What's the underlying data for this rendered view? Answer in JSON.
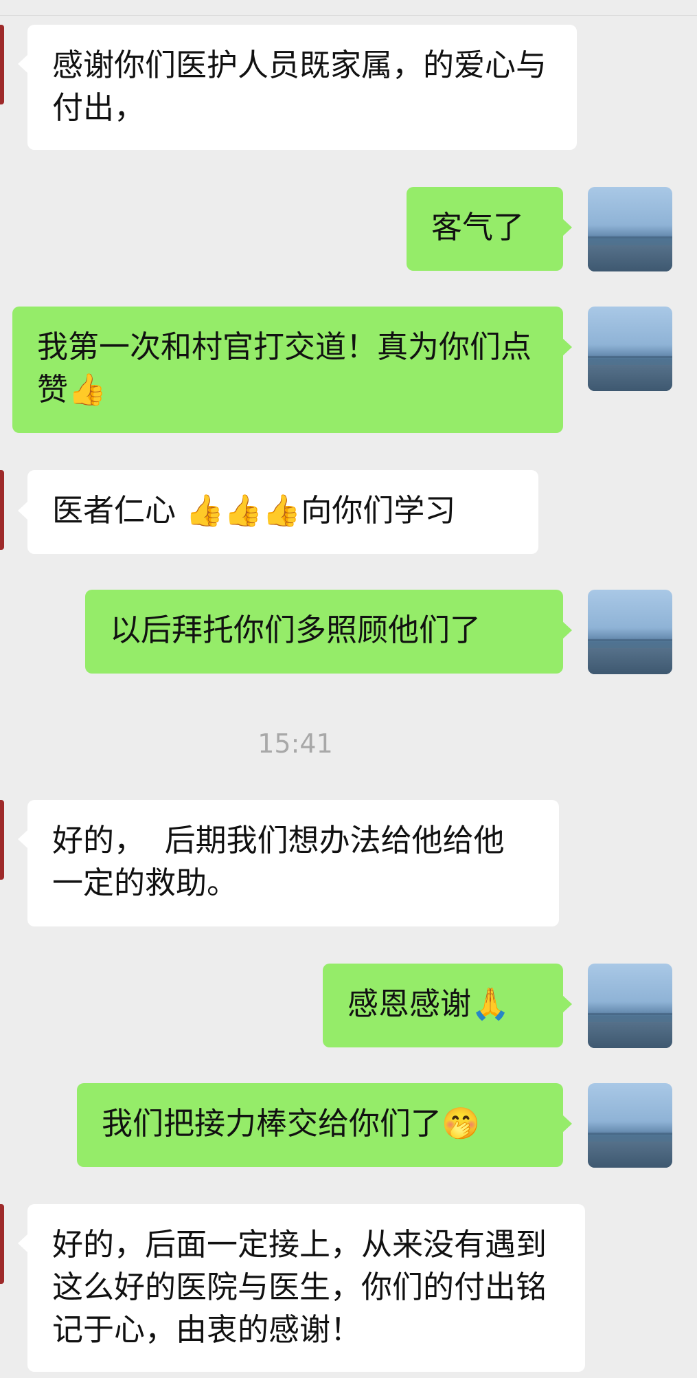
{
  "chat": {
    "messages": [
      {
        "side": "recv",
        "text": "感谢你们医护人员既家属，的爱心与付出，"
      },
      {
        "side": "sent",
        "text": "客气了"
      },
      {
        "side": "sent",
        "text": "我第一次和村官打交道！真为你们点赞👍"
      },
      {
        "side": "recv",
        "text": "医者仁心 👍👍👍向你们学习"
      },
      {
        "side": "sent",
        "text": "以后拜托你们多照顾他们了"
      },
      {
        "side": "recv",
        "text": "好的，  后期我们想办法给他给他一定的救助。"
      },
      {
        "side": "sent",
        "text": "感恩感谢🙏"
      },
      {
        "side": "sent",
        "text": "我们把接力棒交给你们了🤭"
      },
      {
        "side": "recv",
        "text": "好的，后面一定接上，从来没有遇到这么好的医院与医生，你们的付出铭记于心，由衷的感谢！"
      }
    ],
    "timestamp": "15:41"
  },
  "colors": {
    "sent_bubble": "#95ec69",
    "recv_bubble": "#ffffff",
    "background": "#ededed"
  }
}
